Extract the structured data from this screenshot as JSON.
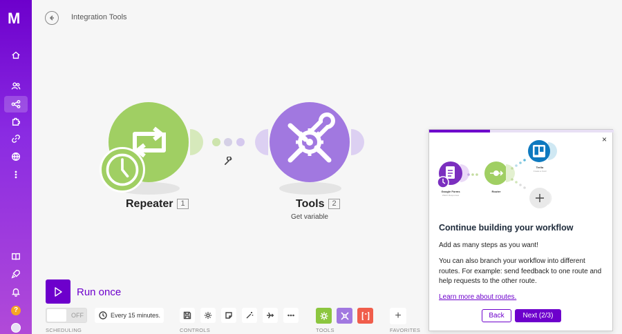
{
  "app": {
    "logo_text": "M"
  },
  "header": {
    "title": "Integration Tools"
  },
  "sidebar": {
    "items": [
      {
        "name": "home-icon"
      },
      {
        "name": "team-icon"
      },
      {
        "name": "scenarios-icon",
        "active": true
      },
      {
        "name": "apps-icon"
      },
      {
        "name": "connections-icon"
      },
      {
        "name": "webhooks-icon"
      },
      {
        "name": "more-icon"
      },
      {
        "name": "docs-icon"
      },
      {
        "name": "whats-new-icon"
      },
      {
        "name": "notifications-icon"
      }
    ],
    "help_label": "?"
  },
  "modules": [
    {
      "name": "Repeater",
      "number": "1",
      "subtitle": "",
      "color": "#a0cf63"
    },
    {
      "name": "Tools",
      "number": "2",
      "subtitle": "Get variable",
      "color": "#a178e0"
    }
  ],
  "run": {
    "label": "Run once"
  },
  "toolbar": {
    "scheduling": {
      "toggle_label": "OFF",
      "schedule": "Every 15 minutes.",
      "section": "SCHEDULING"
    },
    "controls": {
      "section": "CONTROLS",
      "buttons": [
        "save-icon",
        "settings-icon",
        "notes-icon",
        "auto-align-icon",
        "explain-flow-icon",
        "more-icon"
      ]
    },
    "tools": {
      "section": "TOOLS",
      "buttons": [
        {
          "name": "tools-green-icon",
          "color": "#8cc63f"
        },
        {
          "name": "flow-control-icon",
          "color": "#a178e0"
        },
        {
          "name": "text-parser-icon",
          "color": "#f05d4b"
        }
      ]
    },
    "favorites": {
      "section": "FAVORITES",
      "add_label": "+"
    }
  },
  "panel": {
    "progress": 0.33,
    "close_label": "×",
    "illustration": {
      "google_forms_label": "Google Forms",
      "google_forms_sub": "Watch Responses",
      "router_label": "Router",
      "trello_label": "Trello",
      "trello_sub": "Create a Card"
    },
    "title": "Continue building your workflow",
    "paragraph1": "Add as many steps as you want!",
    "paragraph2": "You can also branch your workflow into different routes. For example: send feedback to one route and help requests to the other route.",
    "link": "Learn more about routes.",
    "back_label": "Back",
    "next_label": "Next (2/3)"
  },
  "colors": {
    "accent": "#6d00cc",
    "repeater": "#a0cf63",
    "tools": "#a178e0"
  }
}
